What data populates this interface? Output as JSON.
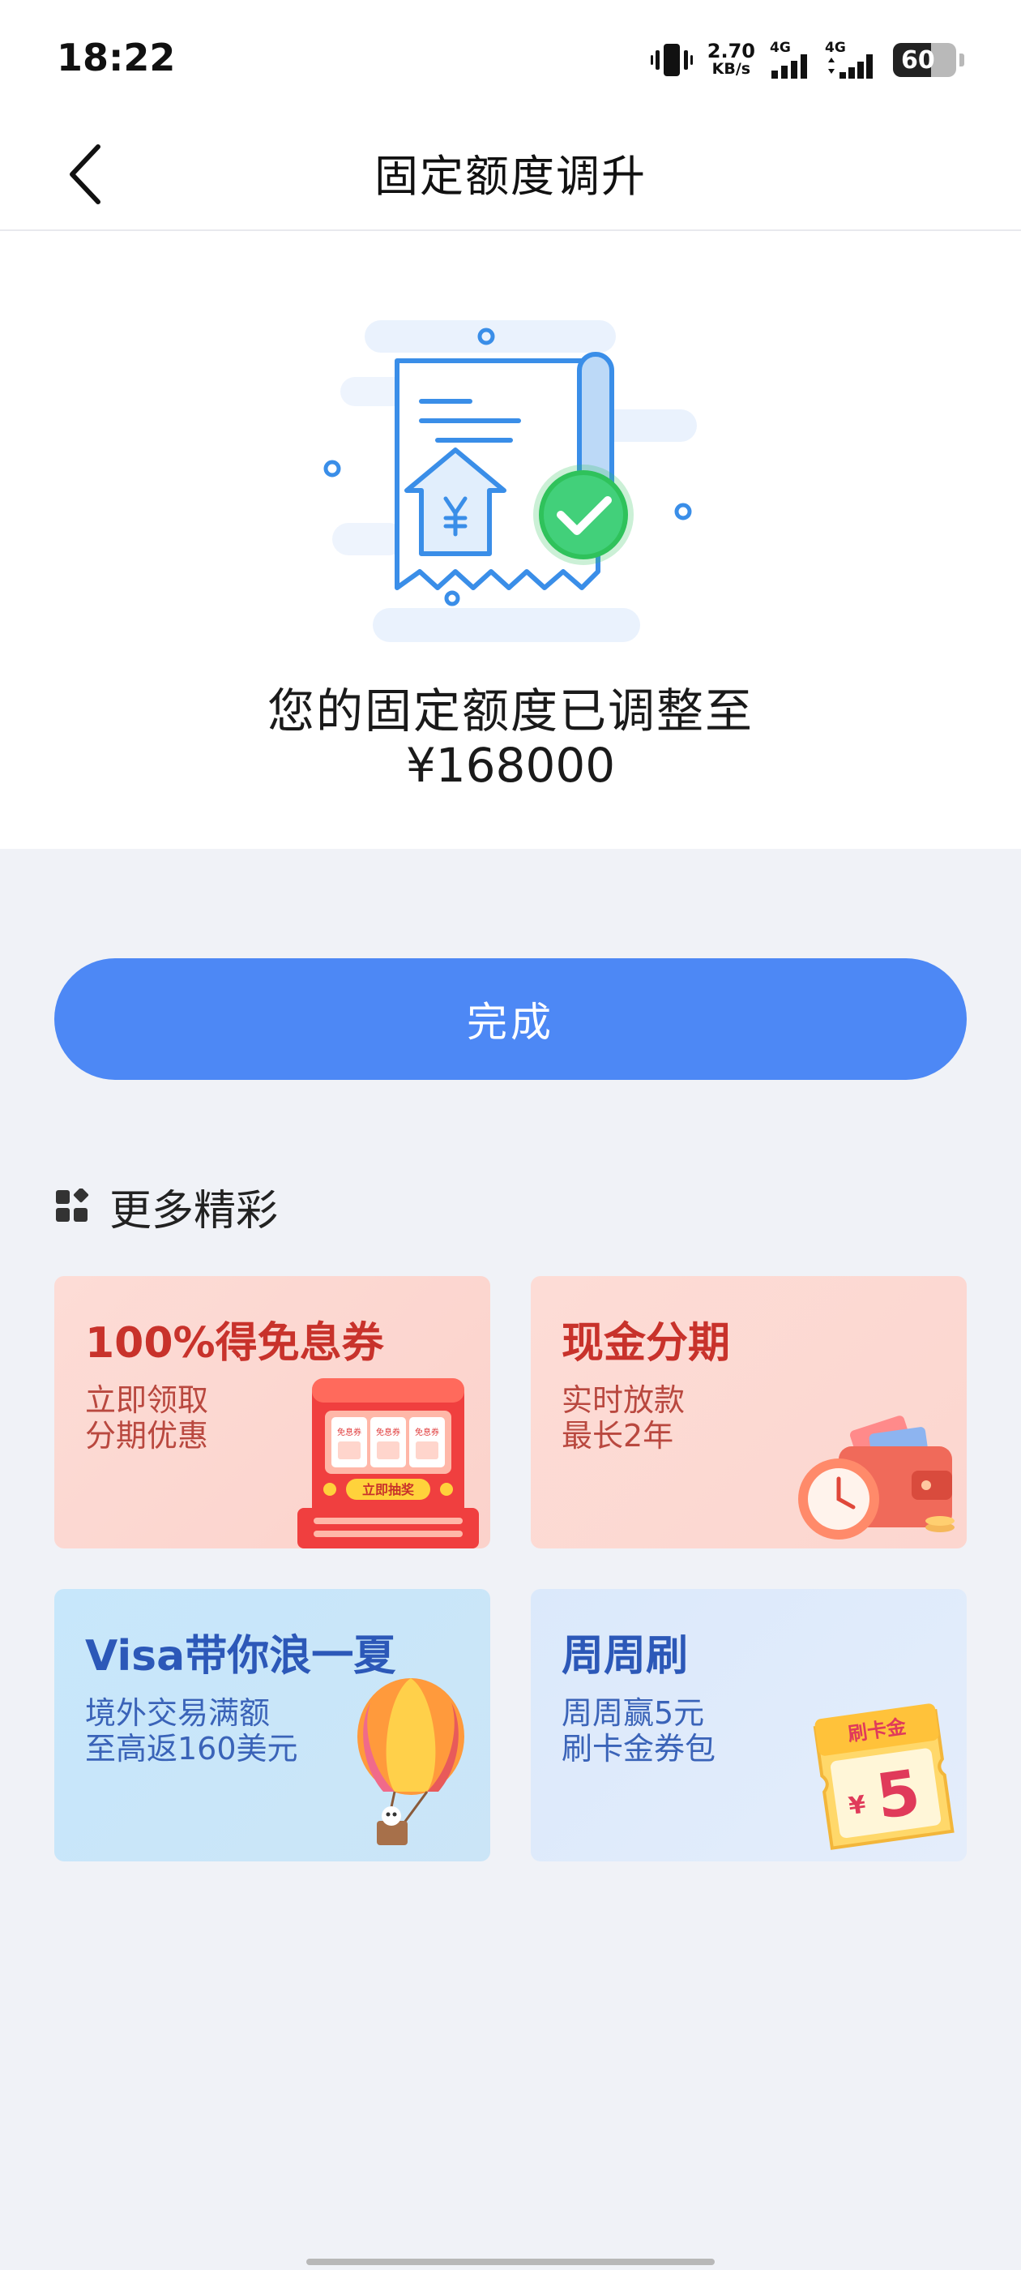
{
  "status": {
    "time": "18:22",
    "speed_value": "2.70",
    "speed_unit": "KB/s",
    "sig1": "4G",
    "sig2": "4G",
    "battery": "60",
    "battery_level": 0.6
  },
  "nav": {
    "title": "固定额度调升"
  },
  "result": {
    "message": "您的固定额度已调整至",
    "amount": "¥168000"
  },
  "done_button": "完成",
  "more": {
    "title": "更多精彩",
    "cards": [
      {
        "title": "100%得免息券",
        "line1": "立即领取",
        "line2": "分期优惠",
        "art_label": "立即抽奖",
        "art_tickets": [
          "免息券",
          "免息券",
          "免息券"
        ]
      },
      {
        "title": "现金分期",
        "line1": "实时放款",
        "line2": "最长2年"
      },
      {
        "title": "Visa带你浪一夏",
        "line1": "境外交易满额",
        "line2": "至高返160美元"
      },
      {
        "title": "周周刷",
        "line1": "周周赢5元",
        "line2": "刷卡金券包",
        "art_label": "刷卡金",
        "art_currency": "¥",
        "art_value": "5"
      }
    ]
  },
  "colors": {
    "primary": "#4d88f5",
    "success": "#2fc25b",
    "card_red_title": "#c8322b",
    "card_blue_title": "#2c58b8"
  }
}
